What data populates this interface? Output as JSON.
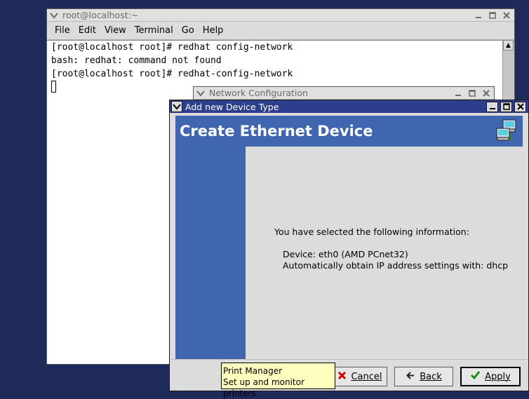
{
  "terminal_window": {
    "title": "root@localhost:~",
    "menu": [
      "File",
      "Edit",
      "View",
      "Terminal",
      "Go",
      "Help"
    ],
    "lines": [
      "[root@localhost root]# redhat config-network",
      "bash: redhat: command not found",
      "[root@localhost root]# redhat-config-network"
    ]
  },
  "network_window": {
    "title": "Network Configuration"
  },
  "dialog": {
    "title": "Add new Device Type",
    "banner_title": "Create Ethernet Device",
    "info_heading": "You have selected the following information:",
    "device_line": "Device: eth0 (AMD PCnet32)",
    "ip_line": "Automatically obtain IP address settings with: dhcp",
    "cancel_label": "Cancel",
    "back_label": "Back",
    "apply_label": "Apply"
  },
  "tooltip": {
    "title": "Print Manager",
    "description": "Set up and monitor printers"
  },
  "colors": {
    "title_active": "#2d3f8c",
    "banner": "#4066b0",
    "desktop": "#1e2a5a",
    "tooltip_bg": "#ffffbf"
  },
  "icons": [
    "window-menu-icon",
    "minimize-icon",
    "maximize-icon",
    "close-icon",
    "network-computers-icon",
    "cancel-x-icon",
    "back-arrow-icon",
    "apply-check-icon",
    "scroll-up-arrow-icon"
  ]
}
